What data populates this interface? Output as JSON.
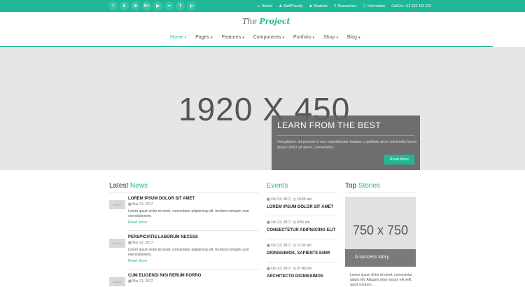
{
  "topbar": {
    "socials": [
      {
        "icon": "twitter-icon",
        "glyph": "t"
      },
      {
        "icon": "skype-icon",
        "glyph": "S"
      },
      {
        "icon": "linkedin-icon",
        "glyph": "in"
      },
      {
        "icon": "google-plus-icon",
        "glyph": "G+"
      },
      {
        "icon": "youtube-icon",
        "glyph": "▶"
      },
      {
        "icon": "flickr-icon",
        "glyph": "••"
      },
      {
        "icon": "facebook-icon",
        "glyph": "f"
      },
      {
        "icon": "pinterest-icon",
        "glyph": "p"
      }
    ],
    "links": [
      {
        "icon": "users-icon",
        "glyph": "☺",
        "label": "Alumni"
      },
      {
        "icon": "user-icon",
        "glyph": "♟",
        "label": "Staff/Faculty"
      },
      {
        "icon": "user-icon",
        "glyph": "♟",
        "label": "Students"
      },
      {
        "icon": "search-icon",
        "glyph": "⚲",
        "label": "Researches"
      },
      {
        "icon": "info-icon",
        "glyph": "ⓘ",
        "label": "Information"
      }
    ],
    "phone": "Call Us: +12 123 123 123"
  },
  "header": {
    "logo_the": "The",
    "logo_project": "Project"
  },
  "nav": [
    {
      "label": "Home",
      "active": true
    },
    {
      "label": "Pages",
      "active": false
    },
    {
      "label": "Features",
      "active": false
    },
    {
      "label": "Components",
      "active": false
    },
    {
      "label": "Portfolio",
      "active": false
    },
    {
      "label": "Shop",
      "active": false
    },
    {
      "label": "Blog",
      "active": false
    }
  ],
  "hero": {
    "dimension": "1920 X 450",
    "title": "LEARN FROM THE BEST",
    "text": "Voluptatem ad provident non repudiandae beatae cupiditate amet reiciendis lorem ipsum dolor sit amet, consectetur.",
    "button": "Read More"
  },
  "latest_news": {
    "heading_a": "Latest",
    "heading_b": "News",
    "items": [
      {
        "title": "LOREM IPSUM DOLOR SIT AMET",
        "date": "Mar 23, 2017",
        "text": "Lorem ipsum dolor sit amet, consectetur adipisicing elit. Incidunt comupti, cum exercitationem.",
        "more": "Read More",
        "thumb": "300x200"
      },
      {
        "title": "PERSPICIATIS LABORUM NECESS",
        "date": "Mar 22, 2017",
        "text": "Lorem ipsum dolor sit amet, consectetur adipisicing elit. Incidunt comupti, cum exercitationem.",
        "more": "Read More",
        "thumb": "300x200"
      },
      {
        "title": "CUM ELIGENDI NISI RERUM PORRO",
        "date": "Mar 21, 2017",
        "text": "",
        "more": "",
        "thumb": "300x200"
      }
    ]
  },
  "events": {
    "heading": "Events",
    "items": [
      {
        "date": "Oct 23, 2017",
        "time": "10:25 am",
        "title": "LOREM IPSUM DOLOR SIT AMET"
      },
      {
        "date": "Oct 23, 2017",
        "time": "9:55 am",
        "title": "CONSECTETUR ADIPISICING ELIT"
      },
      {
        "date": "Oct 23, 2017",
        "time": "11:05 am",
        "title": "DIGNISSIMOS, SAPIENTE ENIM"
      },
      {
        "date": "Oct 23, 2017",
        "time": "07:45 pm",
        "title": "ARCHITECTO DIGNISSIMOS"
      }
    ]
  },
  "top_stories": {
    "heading_a": "Top",
    "heading_b": "Stories",
    "image_dim": "750 x 750",
    "caption": "A success story",
    "text": "Lorem ipsum dolor sit amet, consectetur adipis elit. Aliquam sitam ipsum elit velit quod nostrum..."
  },
  "colors": {
    "accent": "#1fb897",
    "hero_bg": "#e6e6e6",
    "overlay": "#646464"
  }
}
